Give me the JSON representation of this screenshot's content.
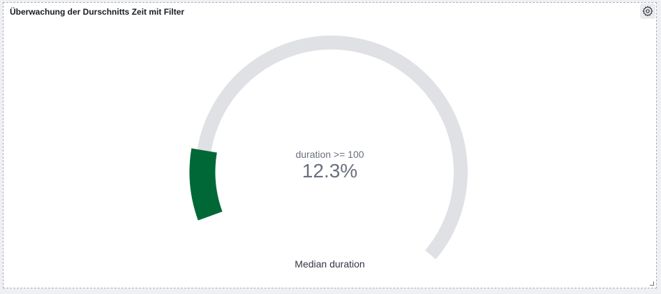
{
  "panel": {
    "title": "Überwachung der Durschnitts Zeit mit Filter",
    "options_icon": "gear-icon",
    "resize_icon": "resize-handle-icon"
  },
  "gauge": {
    "sublabel": "duration >= 100",
    "value_text": "12.3%",
    "label": "Median duration",
    "fraction": 0.123,
    "colors": {
      "track": "#e0e1e5",
      "fill": "#006837"
    }
  }
}
